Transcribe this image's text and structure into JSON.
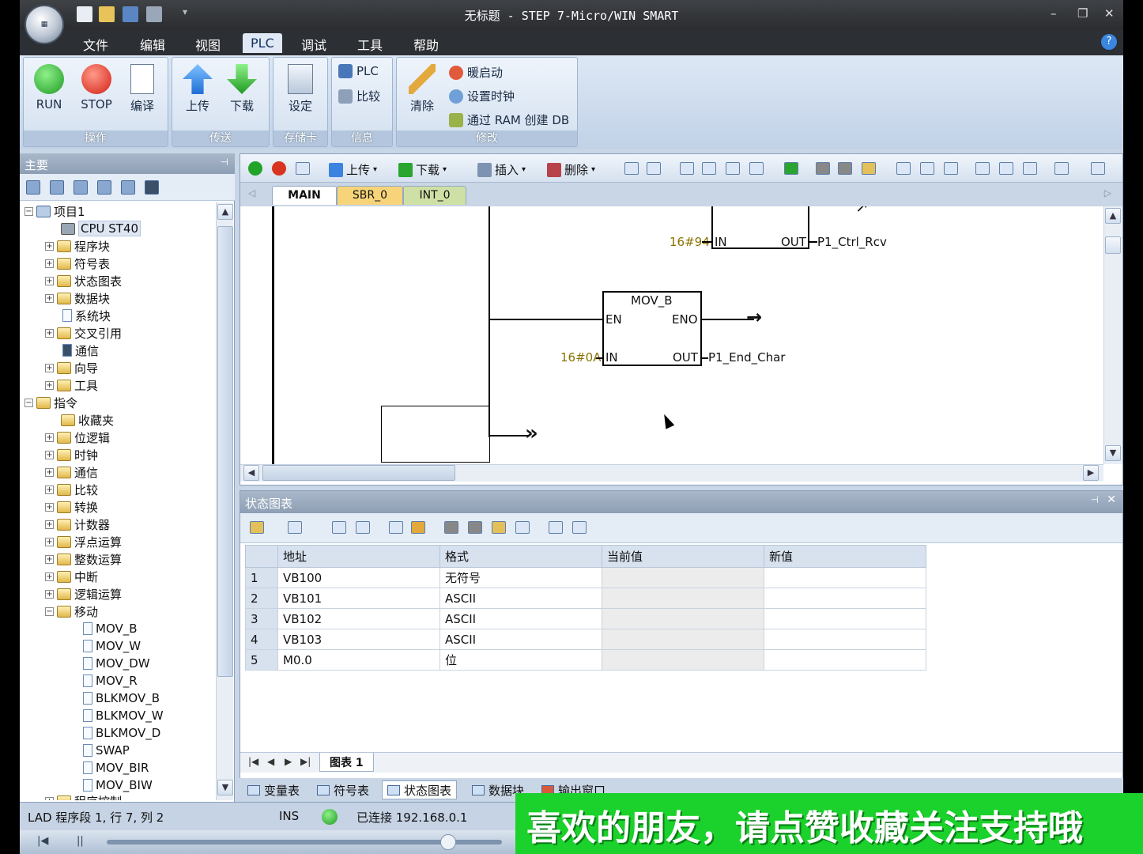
{
  "window": {
    "title": "无标题 - STEP 7-Micro/WIN SMART",
    "controls": [
      "–",
      "❐",
      "✕"
    ]
  },
  "menu": {
    "items": [
      "文件",
      "编辑",
      "视图",
      "PLC",
      "调试",
      "工具",
      "帮助"
    ],
    "active": "PLC"
  },
  "ribbon": {
    "groups": [
      "操作",
      "传送",
      "存储卡",
      "信息",
      "修改"
    ],
    "run": "RUN",
    "stop": "STOP",
    "compile": "编译",
    "upload": "上传",
    "download": "下载",
    "setup": "设定",
    "plc_info": "PLC",
    "compare": "比较",
    "clear": "清除",
    "warm_start": "暖启动",
    "set_clock": "设置时钟",
    "create_db": "通过 RAM 创建 DB"
  },
  "left_pane": {
    "title": "主要",
    "pin": "ᵖ",
    "project": "项目1",
    "cpu": "CPU ST40",
    "project_items": [
      "程序块",
      "符号表",
      "状态图表",
      "数据块",
      "系统块",
      "交叉引用",
      "通信",
      "向导",
      "工具"
    ],
    "instructions": "指令",
    "instruction_items": [
      "收藏夹",
      "位逻辑",
      "时钟",
      "通信",
      "比较",
      "转换",
      "计数器",
      "浮点运算",
      "整数运算",
      "中断",
      "逻辑运算",
      "移动"
    ],
    "move_items": [
      "MOV_B",
      "MOV_W",
      "MOV_DW",
      "MOV_R",
      "BLKMOV_B",
      "BLKMOV_W",
      "BLKMOV_D",
      "SWAP",
      "MOV_BIR",
      "MOV_BIW"
    ],
    "cut_item": "程序控制"
  },
  "editor": {
    "toolbar": {
      "upload": "上传",
      "download": "下载",
      "insert": "插入",
      "delete": "删除"
    },
    "tabs": [
      "MAIN",
      "SBR_0",
      "INT_0"
    ],
    "ladder": {
      "block1": {
        "in_const": "16#94",
        "in": "IN",
        "out": "OUT",
        "out_var": "P1_Ctrl_Rcv"
      },
      "block2": {
        "name": "MOV_B",
        "en": "EN",
        "eno": "ENO",
        "in_const": "16#0A",
        "in": "IN",
        "out": "OUT",
        "out_var": "P1_End_Char"
      }
    }
  },
  "status_chart": {
    "title": "状态图表",
    "columns": [
      "地址",
      "格式",
      "当前值",
      "新值"
    ],
    "rows": [
      {
        "n": "1",
        "addr": "VB100",
        "fmt": "无符号",
        "cur": "",
        "new": ""
      },
      {
        "n": "2",
        "addr": "VB101",
        "fmt": "ASCII",
        "cur": "",
        "new": ""
      },
      {
        "n": "3",
        "addr": "VB102",
        "fmt": "ASCII",
        "cur": "",
        "new": ""
      },
      {
        "n": "4",
        "addr": "VB103",
        "fmt": "ASCII",
        "cur": "",
        "new": ""
      },
      {
        "n": "5",
        "addr": "M0.0",
        "fmt": "位",
        "cur": "",
        "new": ""
      }
    ],
    "sheet_tab": "图表 1"
  },
  "bottom_tabs": [
    "变量表",
    "符号表",
    "状态图表",
    "数据块",
    "输出窗口"
  ],
  "statusbar": {
    "position": "LAD 程序段 1, 行 7, 列 2",
    "mode": "INS",
    "connection": "已连接 192.168.0.1"
  },
  "overlay_text": "喜欢的朋友，请点赞收藏关注支持哦"
}
